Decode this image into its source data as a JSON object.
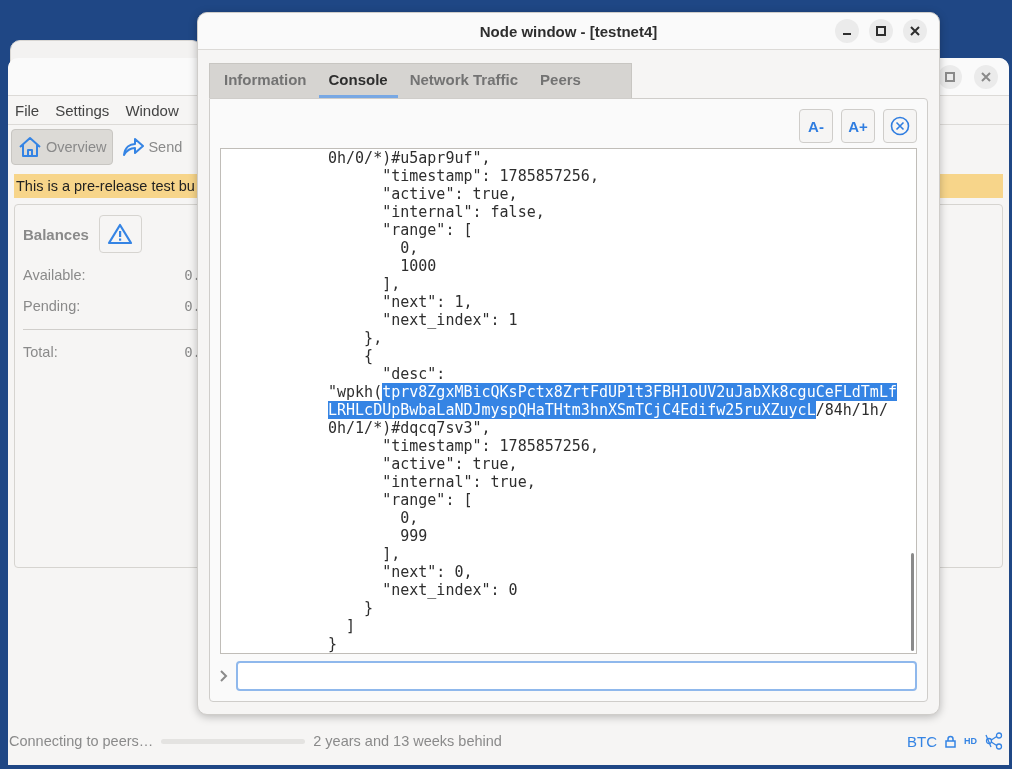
{
  "main_window": {
    "menu": [
      "File",
      "Settings",
      "Window"
    ],
    "toolbar": [
      {
        "label": "Overview",
        "selected": true
      },
      {
        "label": "Send",
        "selected": false
      }
    ],
    "banner": "This is a pre-release test bu",
    "balances": {
      "title": "Balances",
      "rows": [
        {
          "label": "Available:",
          "value": "0.",
          "separator_before": false
        },
        {
          "label": "Pending:",
          "value": "0.",
          "separator_before": false
        },
        {
          "label": "Total:",
          "value": "0.",
          "separator_before": true
        }
      ]
    }
  },
  "node_window": {
    "title": "Node window - [testnet4]",
    "tabs": [
      {
        "label": "Information",
        "selected": false
      },
      {
        "label": "Console",
        "selected": true
      },
      {
        "label": "Network Traffic",
        "selected": false
      },
      {
        "label": "Peers",
        "selected": false
      }
    ],
    "font_buttons": [
      "A-",
      "A+"
    ],
    "console": {
      "lines": [
        [
          {
            "text": "0h/0/*)#u5apr9uf\",",
            "selected": false
          }
        ],
        [
          {
            "text": "      \"timestamp\": 1785857256,",
            "selected": false
          }
        ],
        [
          {
            "text": "      \"active\": true,",
            "selected": false
          }
        ],
        [
          {
            "text": "      \"internal\": false,",
            "selected": false
          }
        ],
        [
          {
            "text": "      \"range\": [",
            "selected": false
          }
        ],
        [
          {
            "text": "        0,",
            "selected": false
          }
        ],
        [
          {
            "text": "        1000",
            "selected": false
          }
        ],
        [
          {
            "text": "      ],",
            "selected": false
          }
        ],
        [
          {
            "text": "      \"next\": 1,",
            "selected": false
          }
        ],
        [
          {
            "text": "      \"next_index\": 1",
            "selected": false
          }
        ],
        [
          {
            "text": "    },",
            "selected": false
          }
        ],
        [
          {
            "text": "    {",
            "selected": false
          }
        ],
        [
          {
            "text": "      \"desc\":",
            "selected": false
          }
        ],
        [
          {
            "text": "\"wpkh(",
            "selected": false
          },
          {
            "text": "tprv8ZgxMBicQKsPctx8ZrtFdUP1t3FBH1oUV2uJabXk8cguCeFLdTmLf",
            "selected": true
          }
        ],
        [
          {
            "text": "LRHLcDUpBwbaLaNDJmyspQHaTHtm3hnXSmTCjC4Edifw25ruXZuycL",
            "selected": true
          },
          {
            "text": "/84h/1h/",
            "selected": false
          }
        ],
        [
          {
            "text": "0h/1/*)#dqcq7sv3\",",
            "selected": false
          }
        ],
        [
          {
            "text": "      \"timestamp\": 1785857256,",
            "selected": false
          }
        ],
        [
          {
            "text": "      \"active\": true,",
            "selected": false
          }
        ],
        [
          {
            "text": "      \"internal\": true,",
            "selected": false
          }
        ],
        [
          {
            "text": "      \"range\": [",
            "selected": false
          }
        ],
        [
          {
            "text": "        0,",
            "selected": false
          }
        ],
        [
          {
            "text": "        999",
            "selected": false
          }
        ],
        [
          {
            "text": "      ],",
            "selected": false
          }
        ],
        [
          {
            "text": "      \"next\": 0,",
            "selected": false
          }
        ],
        [
          {
            "text": "      \"next_index\": 0",
            "selected": false
          }
        ],
        [
          {
            "text": "    }",
            "selected": false
          }
        ],
        [
          {
            "text": "  ]",
            "selected": false
          }
        ],
        [
          {
            "text": "}",
            "selected": false
          }
        ]
      ]
    }
  },
  "status_bar": {
    "sync_status": "Connecting to peers…",
    "progress": {
      "level": 0
    },
    "behind": "2 years and 13 weeks behind",
    "unit": "BTC",
    "hd": "HD"
  }
}
